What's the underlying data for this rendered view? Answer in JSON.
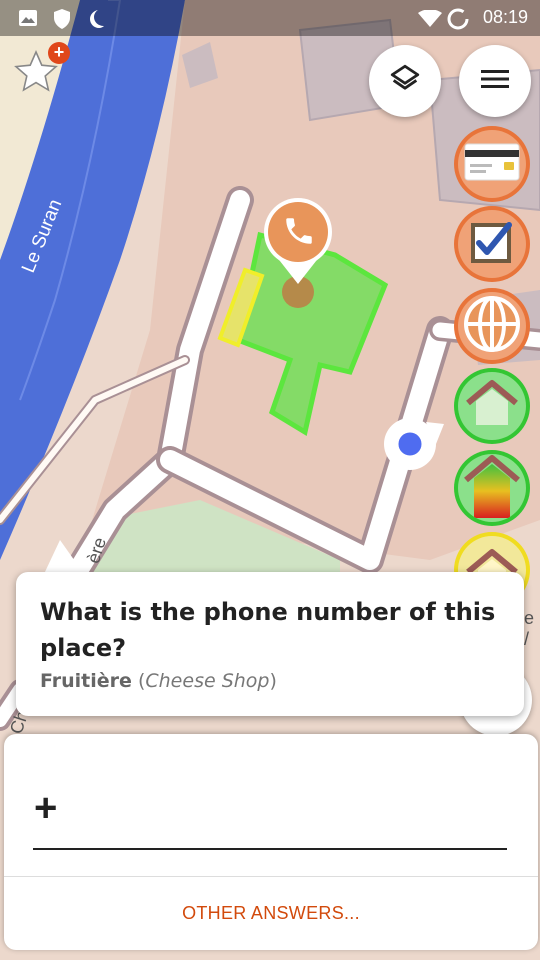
{
  "status_bar": {
    "time": "08:19",
    "left_icons": [
      "image-icon",
      "shield-icon",
      "moon-icon"
    ],
    "right_icons": [
      "wifi-icon",
      "sync-icon"
    ]
  },
  "map": {
    "river_label": "Le Suran",
    "street_label_1": "ère",
    "street_label_2": "Ch",
    "street_label_3": "e /"
  },
  "top_controls": {
    "star_badge": "+",
    "layers_icon": "layers-icon",
    "menu_icon": "menu-icon"
  },
  "quest_buttons": [
    {
      "name": "quest-payment-card",
      "icon": "credit-card-icon",
      "ring": "#e8743a"
    },
    {
      "name": "quest-checkbox",
      "icon": "checkbox-icon",
      "ring": "#e8743a"
    },
    {
      "name": "quest-website",
      "icon": "globe-icon",
      "ring": "#e8743a"
    },
    {
      "name": "quest-house",
      "icon": "house-icon",
      "ring": "#33c633"
    },
    {
      "name": "quest-building-levels",
      "icon": "house-levels-icon",
      "ring": "#33c633"
    },
    {
      "name": "quest-roof",
      "icon": "roof-icon",
      "ring": "#f0dc20"
    }
  ],
  "question": {
    "title": "What is the phone number of this place?",
    "place_name": "Fruitière",
    "place_type": "Cheese Shop"
  },
  "answer": {
    "input_prefix": "+",
    "other_answers": "OTHER ANSWERS..."
  },
  "colors": {
    "accent": "#d24a0c",
    "quest_orange": "#e8743a",
    "highlight_green": "#5cd65c",
    "location_blue": "#4f6cf0"
  }
}
